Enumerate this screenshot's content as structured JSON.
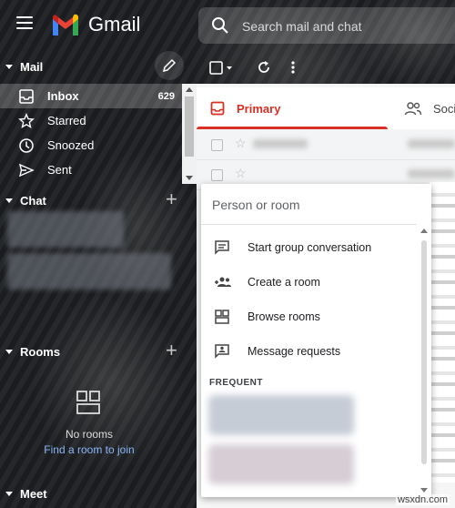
{
  "app": {
    "name": "Gmail"
  },
  "search": {
    "placeholder": "Search mail and chat"
  },
  "mail_section": {
    "title": "Mail",
    "items": [
      {
        "label": "Inbox",
        "count": "629",
        "active": true
      },
      {
        "label": "Starred"
      },
      {
        "label": "Snoozed"
      },
      {
        "label": "Sent"
      }
    ]
  },
  "chat_section": {
    "title": "Chat"
  },
  "rooms_section": {
    "title": "Rooms",
    "empty_text": "No rooms",
    "link_text": "Find a room to join"
  },
  "meet_section": {
    "title": "Meet"
  },
  "tabs": [
    {
      "label": "Primary",
      "active": true,
      "color": "#d93025"
    },
    {
      "label": "Soci"
    }
  ],
  "dropdown": {
    "input_placeholder": "Person or room",
    "items": [
      {
        "label": "Start group conversation",
        "icon": "chat-bubble-icon"
      },
      {
        "label": "Create a room",
        "icon": "group-add-icon"
      },
      {
        "label": "Browse rooms",
        "icon": "grid-icon"
      },
      {
        "label": "Message requests",
        "icon": "person-message-icon"
      }
    ],
    "frequent_label": "FREQUENT"
  },
  "watermark": "wsxdn.com"
}
